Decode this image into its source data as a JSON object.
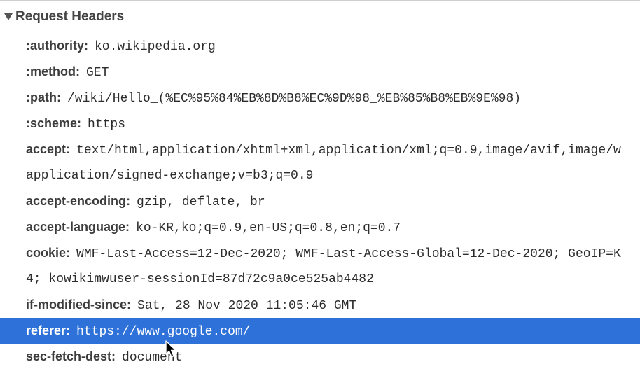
{
  "section": {
    "title": "Request Headers"
  },
  "rows": [
    {
      "name": ":authority:",
      "value": "ko.wikipedia.org"
    },
    {
      "name": ":method:",
      "value": "GET"
    },
    {
      "name": ":path:",
      "value": "/wiki/Hello_(%EC%95%84%EB%8D%B8%EC%9D%98_%EB%85%B8%EB%9E%98)"
    },
    {
      "name": ":scheme:",
      "value": "https"
    },
    {
      "name": "accept:",
      "value": "text/html,application/xhtml+xml,application/xml;q=0.9,image/avif,image/w"
    },
    {
      "value": "application/signed-exchange;v=b3;q=0.9"
    },
    {
      "name": "accept-encoding:",
      "value": "gzip, deflate, br"
    },
    {
      "name": "accept-language:",
      "value": "ko-KR,ko;q=0.9,en-US;q=0.8,en;q=0.7"
    },
    {
      "name": "cookie:",
      "value": "WMF-Last-Access=12-Dec-2020; WMF-Last-Access-Global=12-Dec-2020; GeoIP=K"
    },
    {
      "value": "4; kowikimwuser-sessionId=87d72c9a0ce525ab4482"
    },
    {
      "name": "if-modified-since:",
      "value": "Sat, 28 Nov 2020 11:05:46 GMT"
    },
    {
      "name": "referer:",
      "value": "https://www.google.com/",
      "selected": true
    },
    {
      "name": "sec-fetch-dest:",
      "value": "document"
    }
  ],
  "colors": {
    "selection": "#2e72d9",
    "header_text": "#444444"
  },
  "icons": {
    "expand": "triangle-down-icon",
    "pointer": "mouse-cursor-icon"
  }
}
